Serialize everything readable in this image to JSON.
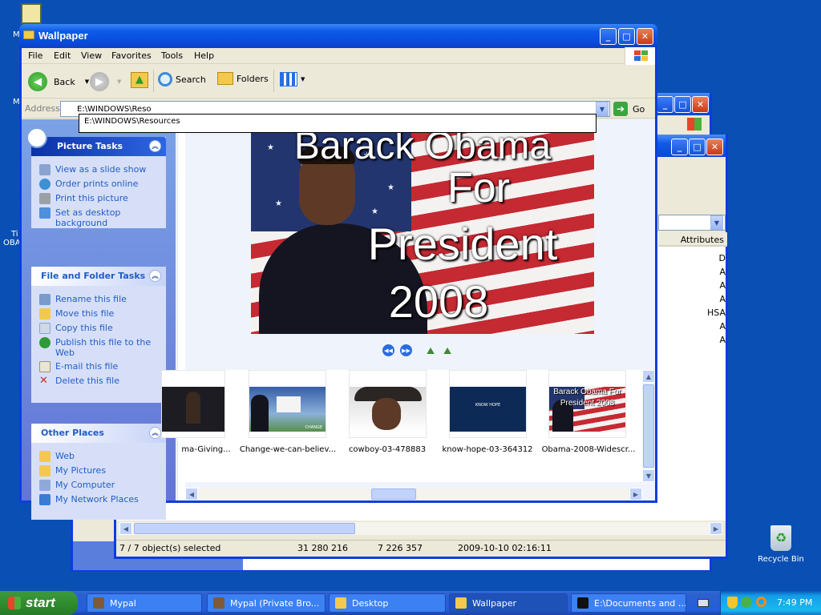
{
  "desktop": {
    "recycle_bin_label": "Recycle Bin",
    "icon_fragments": [
      "M",
      "M",
      "Ti",
      "OBA"
    ]
  },
  "back_window": {
    "attributes_header": "Attributes",
    "attributes": [
      "D",
      "A",
      "A",
      "A",
      "HSA",
      "A",
      "A"
    ],
    "status": {
      "selected": "7 / 7 object(s) selected",
      "size1": "31 280 216",
      "size2": "7 226 357",
      "date": "2009-10-10 02:16:11"
    }
  },
  "window": {
    "title": "Wallpaper",
    "menu": [
      "File",
      "Edit",
      "View",
      "Favorites",
      "Tools",
      "Help"
    ],
    "toolbar": {
      "back": "Back",
      "search": "Search",
      "folders": "Folders"
    },
    "address": {
      "label": "Address",
      "value": "E:\\WINDOWS\\Reso",
      "suggestion": "E:\\WINDOWS\\Resources",
      "go": "Go"
    }
  },
  "taskpane": {
    "picture_tasks": {
      "title": "Picture Tasks",
      "items": [
        "View as a slide show",
        "Order prints online",
        "Print this picture",
        "Set as desktop background"
      ]
    },
    "file_tasks": {
      "title": "File and Folder Tasks",
      "items": [
        "Rename this file",
        "Move this file",
        "Copy this file",
        "Publish this file to the Web",
        "E-mail this file",
        "Delete this file"
      ]
    },
    "other_places": {
      "title": "Other Places",
      "items": [
        "Web",
        "My Pictures",
        "My Computer",
        "My Network Places"
      ]
    }
  },
  "preview": {
    "line1": "Barack Obama",
    "line2": "For",
    "line3": "President",
    "line4": "2008"
  },
  "filmstrip": {
    "thumbs": [
      {
        "label": "ma-Giving..."
      },
      {
        "label": "Change-we-can-believ...",
        "caption": "CHANGE"
      },
      {
        "label": "cowboy-03-478883"
      },
      {
        "label": "know-hope-03-364312",
        "caption": "KNOW HOPE"
      },
      {
        "label": "Obama-2008-Widescr...",
        "caption": "Barack Obama For President 2008"
      }
    ]
  },
  "taskbar": {
    "start": "start",
    "items": [
      "Mypal",
      "Mypal (Private Bro...",
      "Desktop",
      "Wallpaper",
      "E:\\Documents and ..."
    ],
    "clock": "7:49 PM"
  },
  "colors": {
    "desktop": "#0a50b4",
    "titlebar": "#0a49d8",
    "link": "#215dc6",
    "start_green": "#318c31"
  }
}
